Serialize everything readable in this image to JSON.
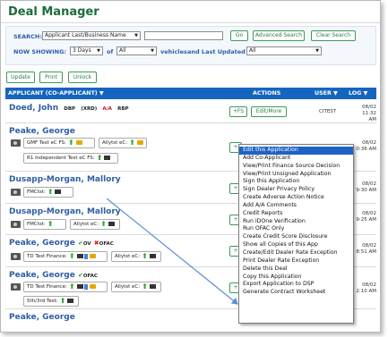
{
  "header": {
    "title": "Deal Manager"
  },
  "search": {
    "label": "SEARCH:",
    "field_select": "Applicant Last/Business Name",
    "input_value": "",
    "go": "Go",
    "advanced": "Advanced Search",
    "clear": "Clear Search",
    "now_showing_label": "NOW SHOWING:",
    "days": "3 Days",
    "of_label": "of",
    "vehicles_select": "All",
    "vehicles_label": "vehicles",
    "updated_by_label": "and Last Updated By",
    "updated_by": "All"
  },
  "toolbar": {
    "update": "Update",
    "print": "Print",
    "unlock": "Unlock"
  },
  "table": {
    "col_applicant": "APPLICANT (CO-APPLICANT) ▼",
    "col_actions": "ACTIONS",
    "col_user": "USER ▼",
    "col_log": "LOG ▼"
  },
  "rows": [
    {
      "name": "Doed, John",
      "tags": [
        "DBP",
        "(XRD)",
        "A/A",
        "RBP"
      ],
      "actions": [
        "+FS",
        "Edit/More"
      ],
      "user": "CITEST",
      "log_date": "08/02",
      "log_time": "11:32 AM"
    },
    {
      "name": "Peake, George",
      "chips": [
        "GMF Test eC FS:",
        "Allytst eC:",
        "R1 Independent Test eC FS:"
      ],
      "action": "+",
      "log_date": "08/02",
      "log_time": "0:36 AM"
    },
    {
      "name": "Dusapp-Morgan, Mallory",
      "chips": [
        "FMCtst:"
      ],
      "action": "+",
      "log_date": "08/02",
      "log_time": "9:30 AM"
    },
    {
      "name": "Dusapp-Morgan, Mallory",
      "chips": [
        "FMCtst:",
        "Allytst eC:"
      ],
      "action": "+",
      "log_date": "08/02",
      "log_time": "9:25 AM"
    },
    {
      "name": "Peake, George",
      "marks": [
        "OV",
        "OFAC"
      ],
      "chips": [
        "TD Test Finance:",
        "Allytst eC:"
      ],
      "action": "+",
      "log_date": "08/02",
      "log_time": "8:51 AM"
    },
    {
      "name": "Peake, George",
      "marks": [
        "OFAC"
      ],
      "chips": [
        "TD Test Finance:",
        "Allytst eC:",
        "5th/3rd Test:"
      ],
      "action": "+",
      "log_date": "08/02",
      "log_time": "2:10 AM"
    },
    {
      "name": "Peake, George"
    }
  ],
  "context_menu": [
    "Edit this Application",
    "Add Co-Applicant",
    "View/Print Finance Source Decision",
    "View/Print Unsigned Application",
    "Sign this Application",
    "Sign Dealer Privacy Policy",
    "Create Adverse Action Notice",
    "Add A/A Comments",
    "Credit Reports",
    "Run IDOne Verification",
    "Run OFAC Only",
    "Create Credit Score Disclosure",
    "Show all Copies of this App",
    "Create/Edit Dealer Rate Exception",
    "Print Dealer Rate Exception",
    "Delete this Deal",
    "Copy this Application",
    "Export Application to DSP",
    "Generate Contract Worksheet"
  ],
  "colors": {
    "accent": "#1565c0",
    "title_green": "#1b6d3b",
    "link_blue": "#2f5da5",
    "highlight": "#1e62c6"
  }
}
